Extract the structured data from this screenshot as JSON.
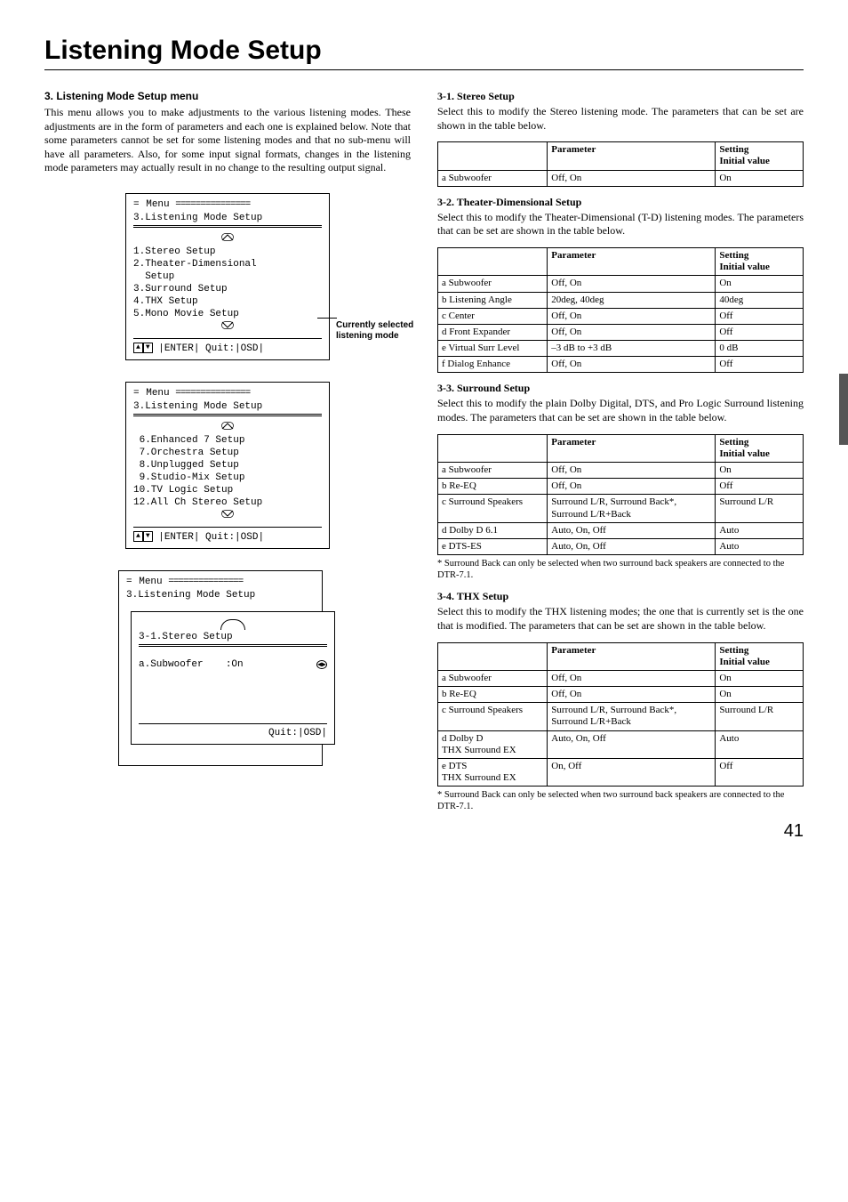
{
  "pageTitle": "Listening Mode Setup",
  "pageNumber": "41",
  "left": {
    "sectionHeading": "3. Listening Mode Setup menu",
    "intro": "This menu allows you to make adjustments to the various listening modes. These adjustments are in the form of parameters and each one is explained below. Note that some parameters cannot be set for some listening modes and that no sub-menu will have all parameters. Also, for some input signal formats, changes in the listening mode parameters may actually result in no change to the resulting output signal.",
    "osd1": {
      "menu": "Menu",
      "title": "3.Listening Mode Setup",
      "items": [
        "1.Stereo Setup",
        "2.Theater-Dimensional",
        "  Setup",
        "3.Surround Setup",
        "4.THX Setup",
        "5.Mono Movie Setup"
      ],
      "footer": "|ENTER| Quit:|OSD|",
      "callout": "Currently selected listening mode"
    },
    "osd2": {
      "menu": "Menu",
      "title": "3.Listening Mode Setup",
      "items": [
        " 6.Enhanced 7 Setup",
        " 7.Orchestra Setup",
        " 8.Unplugged Setup",
        " 9.Studio-Mix Setup",
        "10.TV Logic Setup",
        "12.All Ch Stereo Setup"
      ],
      "footer": "|ENTER| Quit:|OSD|"
    },
    "osd3": {
      "menu": "Menu",
      "backTitle": "3.Listening Mode Setup",
      "frontTitle": "3-1.Stereo Setup",
      "paramLabel": "a.Subwoofer",
      "paramValue": ":On",
      "frontFooter": "Quit:|OSD|"
    }
  },
  "right": {
    "s31": {
      "heading": "3-1. Stereo Setup",
      "intro": "Select this to modify the Stereo listening mode. The parameters that can be set are shown in the table below.",
      "th": [
        "",
        "Parameter",
        "Setting\nInitial value"
      ],
      "rows": [
        [
          "a  Subwoofer",
          "Off, On",
          "On"
        ]
      ]
    },
    "s32": {
      "heading": "3-2. Theater-Dimensional Setup",
      "intro": "Select this to modify the Theater-Dimensional (T-D) listening modes. The parameters that can be set are shown in the table below.",
      "th": [
        "",
        "Parameter",
        "Setting\nInitial value"
      ],
      "rows": [
        [
          "a  Subwoofer",
          "Off, On",
          "On"
        ],
        [
          "b  Listening Angle",
          "20deg, 40deg",
          "40deg"
        ],
        [
          "c  Center",
          "Off, On",
          "Off"
        ],
        [
          "d  Front Expander",
          "Off, On",
          "Off"
        ],
        [
          "e  Virtual Surr Level",
          "–3 dB to +3 dB",
          "0 dB"
        ],
        [
          "f  Dialog Enhance",
          "Off, On",
          "Off"
        ]
      ]
    },
    "s33": {
      "heading": "3-3. Surround Setup",
      "intro": "Select this to modify the plain Dolby Digital, DTS, and Pro Logic Surround listening modes. The parameters that can be set are shown in the table below.",
      "th": [
        "",
        "Parameter",
        "Setting\nInitial value"
      ],
      "rows": [
        [
          "a  Subwoofer",
          "Off, On",
          "On"
        ],
        [
          "b  Re-EQ",
          "Off, On",
          "Off"
        ],
        [
          "c  Surround Speakers",
          "Surround L/R, Surround Back*, Surround L/R+Back",
          "Surround L/R"
        ],
        [
          "d  Dolby D 6.1",
          "Auto, On, Off",
          "Auto"
        ],
        [
          "e  DTS-ES",
          "Auto, On, Off",
          "Auto"
        ]
      ],
      "footnote": "* Surround Back can only be selected when two surround back speakers are connected to the DTR-7.1."
    },
    "s34": {
      "heading": "3-4. THX Setup",
      "intro": "Select this to modify the THX listening modes; the one that is currently set is the one that is modified. The parameters that can be set are shown in the table below.",
      "th": [
        "",
        "Parameter",
        "Setting\nInitial value"
      ],
      "rows": [
        [
          "a  Subwoofer",
          "Off, On",
          "On"
        ],
        [
          "b  Re-EQ",
          "Off, On",
          "On"
        ],
        [
          "c  Surround Speakers",
          "Surround L/R, Surround Back*, Surround L/R+Back",
          "Surround L/R"
        ],
        [
          "d  Dolby D\n    THX Surround EX",
          "Auto, On, Off",
          "Auto"
        ],
        [
          "e  DTS\n    THX Surround EX",
          "On, Off",
          "Off"
        ]
      ],
      "footnote": "* Surround Back can only be selected when two surround back speakers are connected to the DTR-7.1."
    }
  }
}
